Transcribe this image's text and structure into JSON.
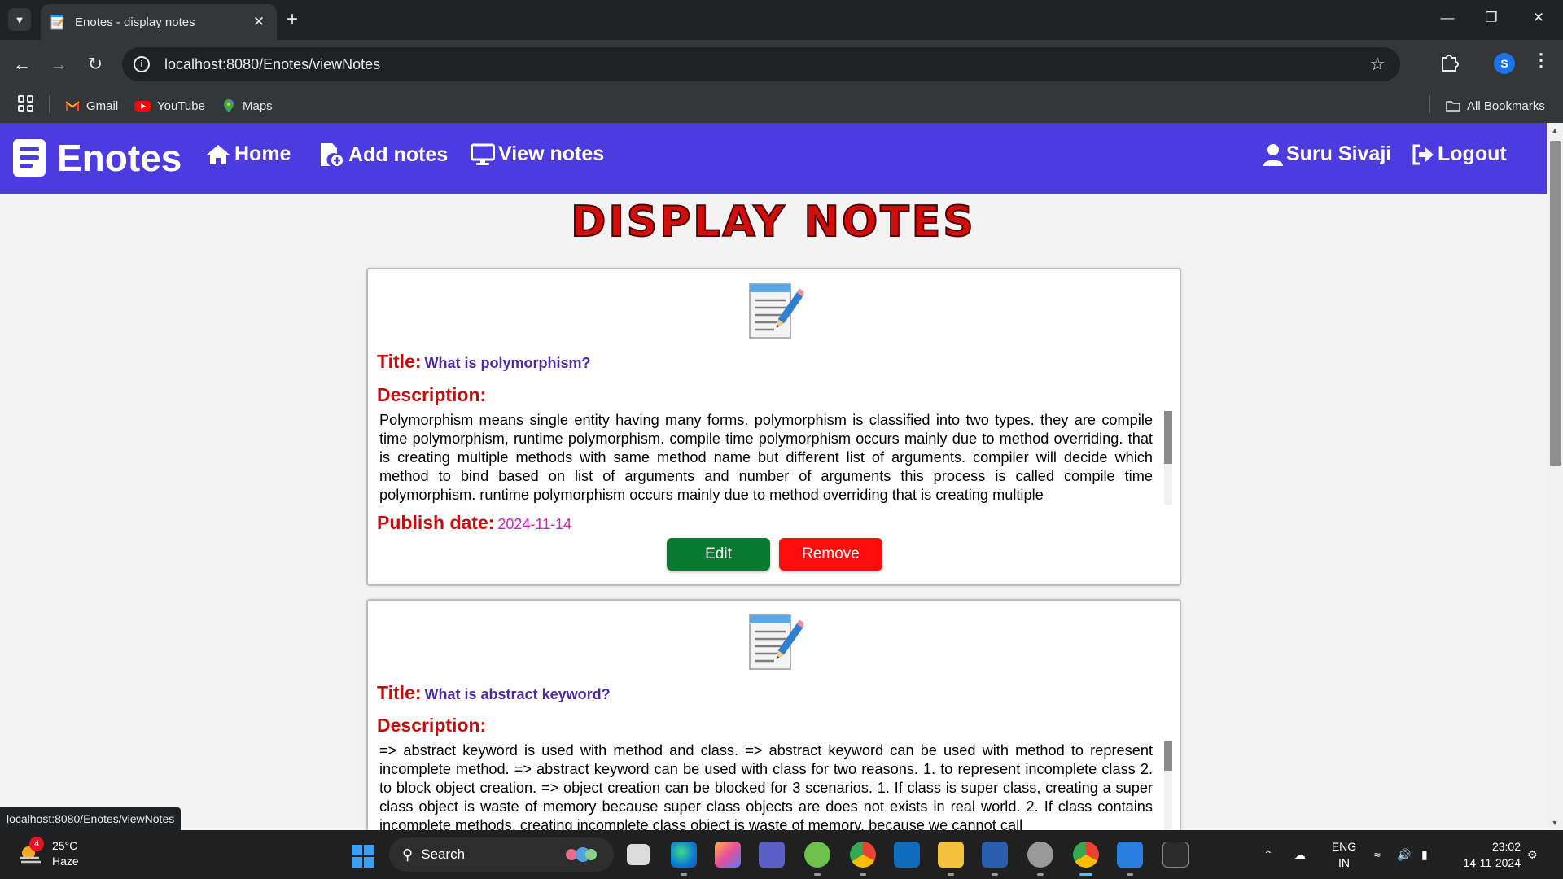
{
  "browser": {
    "tab_title": "Enotes - display notes",
    "tab_close": "✕",
    "new_tab": "+",
    "url": "localhost:8080/Enotes/viewNotes",
    "profile_initial": "S",
    "bookmarks": [
      {
        "label": "Gmail",
        "icon": "gmail-icon"
      },
      {
        "label": "YouTube",
        "icon": "youtube-icon"
      },
      {
        "label": "Maps",
        "icon": "maps-icon"
      }
    ],
    "all_bookmarks": "All Bookmarks",
    "status_url": "localhost:8080/Enotes/viewNotes"
  },
  "navbar": {
    "brand": "Enotes",
    "links": {
      "home": "Home",
      "add_notes": "Add notes",
      "view_notes": "View notes",
      "user": "Suru Sivaji",
      "logout": "Logout"
    }
  },
  "page": {
    "heading": "Display Notes",
    "labels": {
      "title": "Title:",
      "description": "Description:",
      "publish_date": "Publish date:"
    },
    "buttons": {
      "edit": "Edit",
      "remove": "Remove"
    },
    "notes": [
      {
        "title": "What is polymorphism?",
        "description": "Polymorphism means single entity having many forms. polymorphism is classified into two types. they are compile time polymorphism, runtime polymorphism. compile time polymorphism occurs mainly due to method overriding. that is creating multiple methods with same method name but different list of arguments. compiler will decide which method to bind based on list of arguments and number of arguments this process is called compile time polymorphism. runtime polymorphism occurs mainly due to method overriding that is creating multiple",
        "publish_date": "2024-11-14"
      },
      {
        "title": "What is abstract keyword?",
        "description": "=> abstract keyword is used with method and class. => abstract keyword can be used with method to represent incomplete method. => abstract keyword can be used with class for two reasons. 1. to represent incomplete class 2. to block object creation. => object creation can be blocked for 3 scenarios. 1. If class is super class, creating a super class object is waste of memory because super class objects are does not exists in real world. 2. If class contains incomplete methods, creating incomplete class object is waste of memory, because we cannot call"
      }
    ]
  },
  "taskbar": {
    "weather_temp": "25°C",
    "weather_desc": "Haze",
    "weather_badge": "4",
    "search_placeholder": "Search",
    "lang_line1": "ENG",
    "lang_line2": "IN",
    "time": "23:02",
    "date": "14-11-2024"
  },
  "colors": {
    "navbar": "#4c3bde",
    "heading": "#d40d0d",
    "label": "#c40c0c",
    "title_value": "#4b2aa5",
    "date_value": "#d61bc7",
    "edit_button": "#0a7a30",
    "remove_button": "#ff0b0b"
  }
}
